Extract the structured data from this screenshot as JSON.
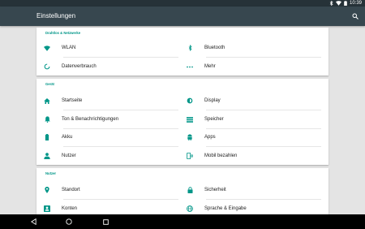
{
  "status": {
    "time": "10:39"
  },
  "appbar": {
    "title": "Einstellungen",
    "search_icon": "search-icon"
  },
  "sections": [
    {
      "header": "Drahtlos & Netzwerke",
      "items": [
        {
          "label": "WLAN",
          "icon": "wifi-icon"
        },
        {
          "label": "Bluetooth",
          "icon": "bluetooth-icon"
        },
        {
          "label": "Datenverbrauch",
          "icon": "data-usage-icon"
        },
        {
          "label": "Mehr",
          "icon": "more-icon"
        }
      ]
    },
    {
      "header": "Gerät",
      "items": [
        {
          "label": "Startseite",
          "icon": "home-icon"
        },
        {
          "label": "Display",
          "icon": "brightness-icon"
        },
        {
          "label": "Ton & Benachrichtigungen",
          "icon": "bell-icon"
        },
        {
          "label": "Speicher",
          "icon": "storage-icon"
        },
        {
          "label": "Akku",
          "icon": "battery-icon"
        },
        {
          "label": "Apps",
          "icon": "android-icon"
        },
        {
          "label": "Nutzer",
          "icon": "person-icon"
        },
        {
          "label": "Mobil bezahlen",
          "icon": "tap-pay-icon"
        }
      ]
    },
    {
      "header": "Nutzer",
      "items": [
        {
          "label": "Standort",
          "icon": "location-icon"
        },
        {
          "label": "Sicherheit",
          "icon": "lock-icon"
        },
        {
          "label": "Konten",
          "icon": "account-box-icon"
        },
        {
          "label": "Sprache & Eingabe",
          "icon": "language-icon"
        }
      ]
    }
  ],
  "colors": {
    "statusbar": "#263238",
    "appbar": "#37474f",
    "accent": "#009688",
    "icon": "#009688"
  }
}
